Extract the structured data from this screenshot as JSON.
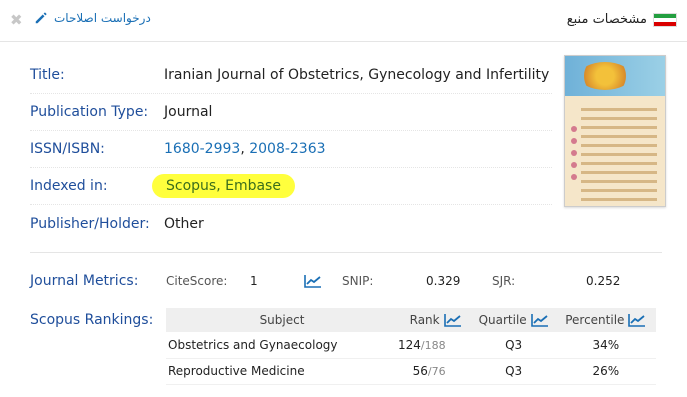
{
  "header": {
    "close_glyph": "✖",
    "edit_label": "درخواست اصلاحات",
    "title": "مشخصات منبع"
  },
  "info": {
    "title_label": "Title:",
    "title_value": "Iranian Journal of Obstetrics, Gynecology and Infertility",
    "pubtype_label": "Publication Type:",
    "pubtype_value": "Journal",
    "issn_label": "ISSN/ISBN:",
    "issn_1": "1680-2993",
    "issn_sep": ", ",
    "issn_2": "2008-2363",
    "indexed_label": "Indexed in:",
    "indexed_1": "Scopus",
    "indexed_sep": ", ",
    "indexed_2": "Embase",
    "publisher_label": "Publisher/Holder:",
    "publisher_value": "Other"
  },
  "metrics": {
    "label": "Journal Metrics:",
    "citescore_label": "CiteScore:",
    "citescore_value": "1",
    "snip_label": "SNIP:",
    "snip_value": "0.329",
    "sjr_label": "SJR:",
    "sjr_value": "0.252"
  },
  "rankings": {
    "label": "Scopus Rankings:",
    "headers": {
      "subject": "Subject",
      "rank": "Rank",
      "quartile": "Quartile",
      "percentile": "Percentile"
    },
    "rows": [
      {
        "subject": "Obstetrics and Gynaecology",
        "rank": "124",
        "rank_total": "/188",
        "quartile": "Q3",
        "percentile": "34%"
      },
      {
        "subject": "Reproductive Medicine",
        "rank": "56",
        "rank_total": "/76",
        "quartile": "Q3",
        "percentile": "26%"
      }
    ]
  },
  "colors": {
    "label_blue": "#1f4e9b",
    "link_blue": "#1a6fb5",
    "highlight": "#ffff3d"
  }
}
